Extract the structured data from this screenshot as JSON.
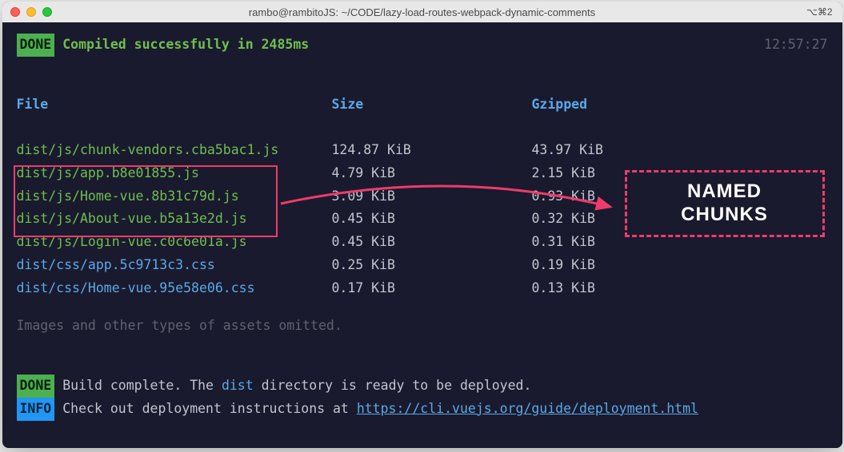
{
  "window": {
    "title": "rambo@rambitoJS: ~/CODE/lazy-load-routes-webpack-dynamic-comments",
    "right_indicator": "⌥⌘2"
  },
  "status_line": {
    "badge": "DONE",
    "message": "Compiled successfully in 2485ms",
    "time": "12:57:27"
  },
  "table": {
    "headers": {
      "file": "File",
      "size": "Size",
      "gzipped": "Gzipped"
    },
    "rows": [
      {
        "file": "dist/js/chunk-vendors.cba5bac1.js",
        "size": "124.87 KiB",
        "gzipped": "43.97 KiB",
        "type": "js"
      },
      {
        "file": "dist/js/app.b8e01855.js",
        "size": "4.79 KiB",
        "gzipped": "2.15 KiB",
        "type": "js"
      },
      {
        "file": "dist/js/Home-vue.8b31c79d.js",
        "size": "3.09 KiB",
        "gzipped": "0.93 KiB",
        "type": "js"
      },
      {
        "file": "dist/js/About-vue.b5a13e2d.js",
        "size": "0.45 KiB",
        "gzipped": "0.32 KiB",
        "type": "js"
      },
      {
        "file": "dist/js/Login-vue.c0c6e01a.js",
        "size": "0.45 KiB",
        "gzipped": "0.31 KiB",
        "type": "js"
      },
      {
        "file": "dist/css/app.5c9713c3.css",
        "size": "0.25 KiB",
        "gzipped": "0.19 KiB",
        "type": "css"
      },
      {
        "file": "dist/css/Home-vue.95e58e06.css",
        "size": "0.17 KiB",
        "gzipped": "0.13 KiB",
        "type": "css"
      }
    ]
  },
  "omitted_note": "Images and other types of assets omitted.",
  "footer_done": {
    "badge": "DONE",
    "prefix": "Build complete. The ",
    "folder": "dist",
    "suffix": " directory is ready to be deployed."
  },
  "footer_info": {
    "badge": "INFO",
    "prefix": "Check out deployment instructions at ",
    "link": "https://cli.vuejs.org/guide/deployment.html"
  },
  "annotation": {
    "label_line1": "NAMED",
    "label_line2": "CHUNKS"
  }
}
